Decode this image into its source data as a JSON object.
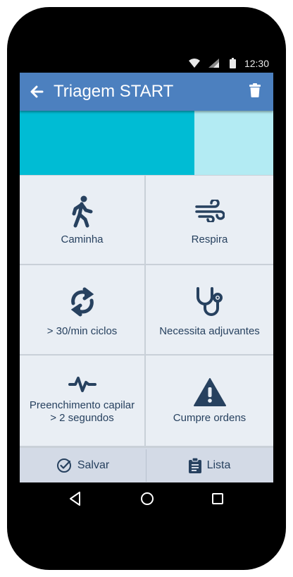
{
  "status_bar": {
    "time": "12:30",
    "wifi_icon": "wifi-icon",
    "signal_icon": "signal-icon",
    "battery_icon": "battery-icon"
  },
  "app_bar": {
    "title": "Triagem START",
    "back_icon": "arrow-left-icon",
    "delete_icon": "trash-icon",
    "color": "#4c80bf"
  },
  "progress": {
    "value": 0.688,
    "fill_color": "#00bcd4",
    "track_color": "#b3ebf3"
  },
  "criteria": [
    {
      "label": "Caminha",
      "icon": "walking-icon"
    },
    {
      "label": "Respira",
      "icon": "wind-icon"
    },
    {
      "label": "> 30/min ciclos",
      "icon": "sync-icon"
    },
    {
      "label": "Necessita adjuvantes",
      "icon": "stethoscope-icon"
    },
    {
      "label": "Preenchimento capilar",
      "label2": "> 2 segundos",
      "icon": "pulse-icon"
    },
    {
      "label": "Cumpre ordens",
      "icon": "warning-icon"
    }
  ],
  "actions": {
    "save_label": "Salvar",
    "save_icon": "check-circle-icon",
    "list_label": "Lista",
    "list_icon": "clipboard-icon"
  },
  "nav": {
    "back_icon": "nav-back-icon",
    "home_icon": "nav-home-icon",
    "recents_icon": "nav-recents-icon"
  }
}
